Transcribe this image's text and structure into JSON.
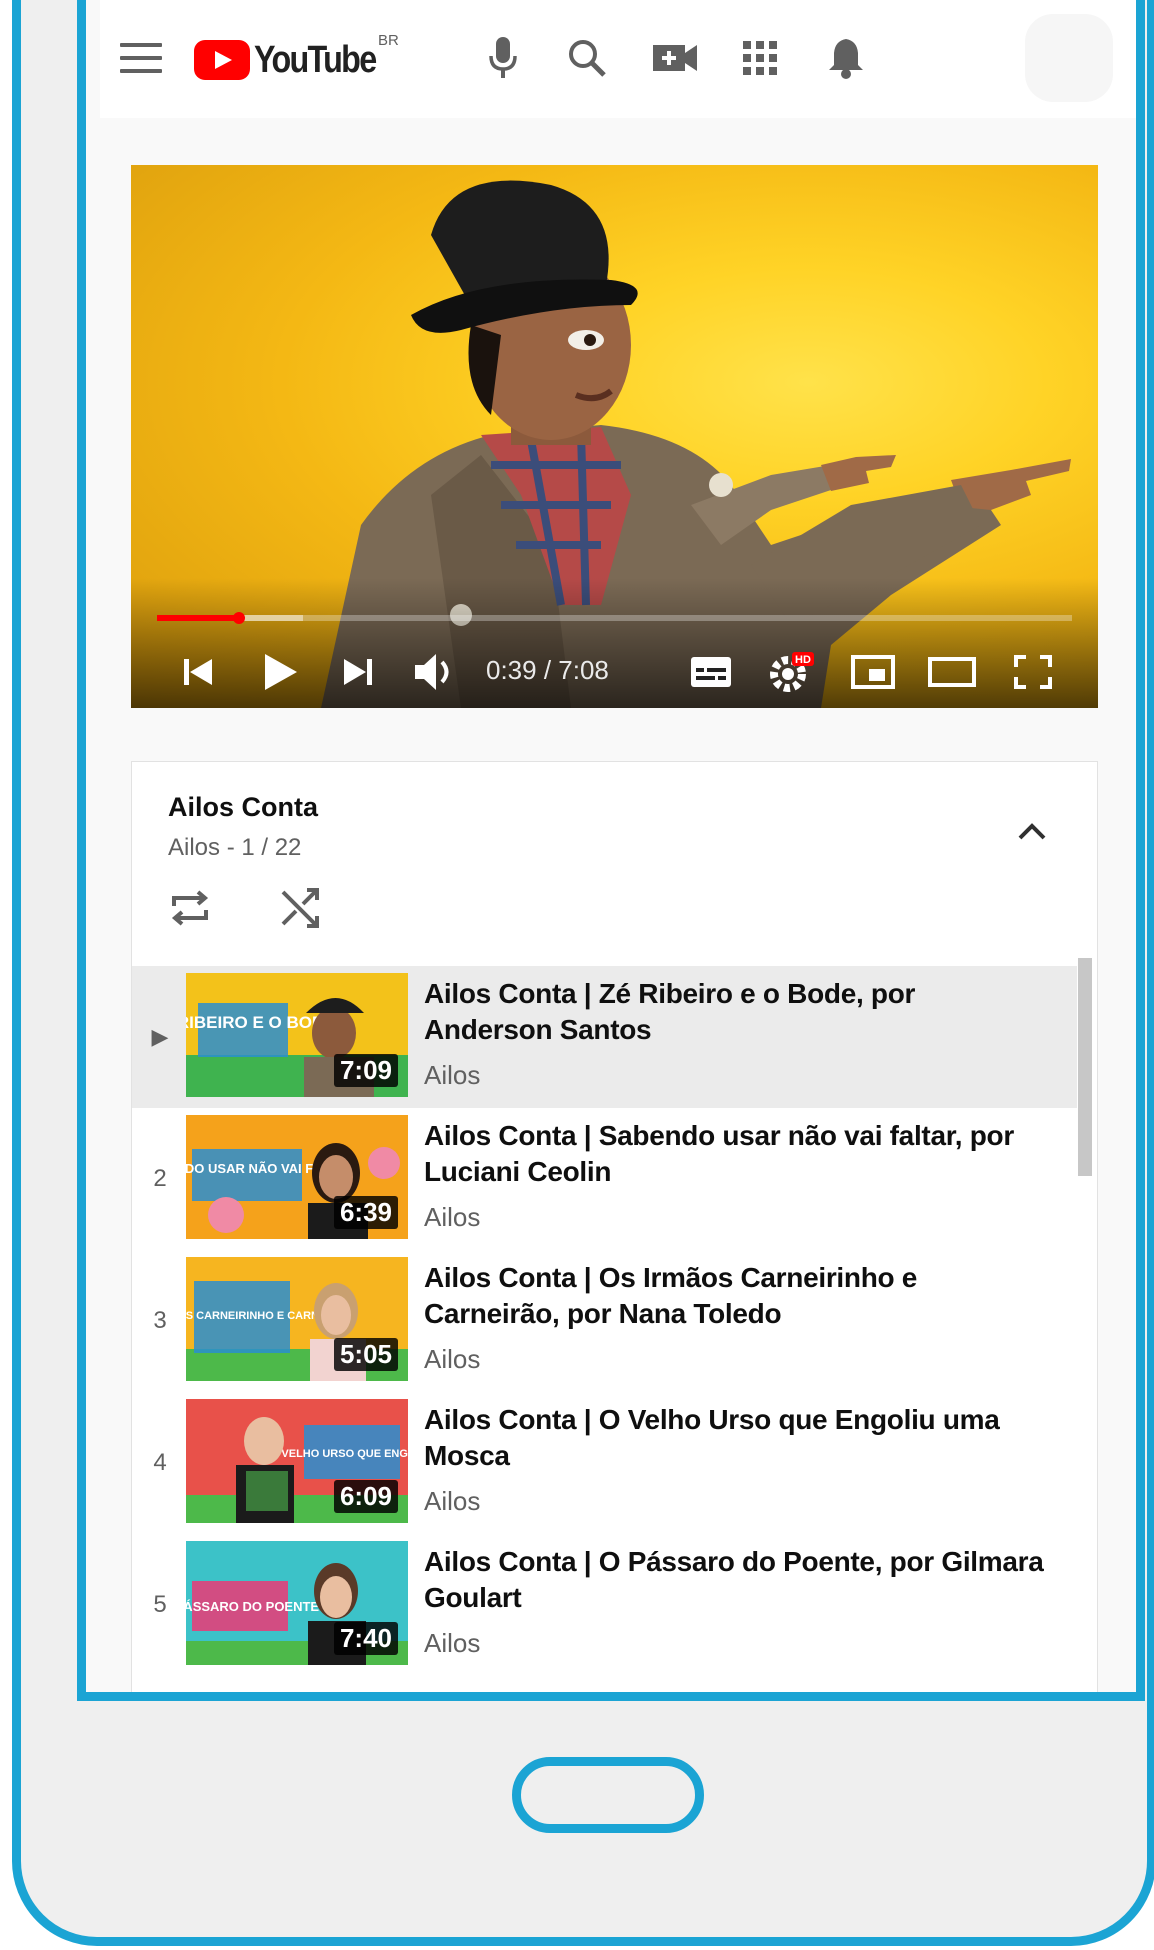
{
  "header": {
    "logo_text": "YouTube",
    "region": "BR",
    "icons": [
      "menu-icon",
      "mic-icon",
      "search-icon",
      "create-video-icon",
      "apps-icon",
      "notifications-icon"
    ]
  },
  "player": {
    "time": "0:39 / 7:08",
    "progress_fraction": 0.09,
    "buffer_fraction": 0.16,
    "hd_badge": "HD",
    "controls": [
      "previous-icon",
      "play-icon",
      "next-icon",
      "volume-icon",
      "subtitles-icon",
      "settings-icon",
      "miniplayer-icon",
      "theater-icon",
      "fullscreen-icon"
    ]
  },
  "playlist": {
    "title": "Ailos Conta",
    "subtitle": "Ailos - 1 / 22",
    "items": [
      {
        "index": "▶",
        "title": "Ailos Conta | Zé Ribeiro e o Bode, por Anderson Santos",
        "channel": "Ailos",
        "duration": "7:09",
        "thumb_text": "ZÉ RIBEIRO E O BODE",
        "bg": "#f3c21a",
        "bg2": "#3fb34f"
      },
      {
        "index": "2",
        "title": "Ailos Conta | Sabendo usar não vai faltar, por Luciani Ceolin",
        "channel": "Ailos",
        "duration": "6:39",
        "thumb_text": "SABENDO USAR NÃO VAI FALTAR",
        "bg": "#f5a21b",
        "bg2": "#f08aa5"
      },
      {
        "index": "3",
        "title": "Ailos Conta | Os Irmãos Carneirinho e Carneirão, por Nana Toledo",
        "channel": "Ailos",
        "duration": "5:05",
        "thumb_text": "OS IRMÃOS CARNEIRINHO E CARNEIRÃO",
        "bg": "#f6b520",
        "bg2": "#4db94a"
      },
      {
        "index": "4",
        "title": "Ailos Conta | O Velho Urso que Engoliu uma Mosca",
        "channel": "Ailos",
        "duration": "6:09",
        "thumb_text": "O VELHO URSO QUE ENGOLIU",
        "bg": "#e8514a",
        "bg2": "#4db94a"
      },
      {
        "index": "5",
        "title": "Ailos Conta | O Pássaro do Poente, por Gilmara Goulart",
        "channel": "Ailos",
        "duration": "7:40",
        "thumb_text": "O PÁSSARO DO POENTE",
        "bg": "#3cc2c8",
        "bg2": "#e2407a"
      }
    ]
  },
  "colors": {
    "accent": "#1ba4d4",
    "brand_red": "#ff0000"
  }
}
